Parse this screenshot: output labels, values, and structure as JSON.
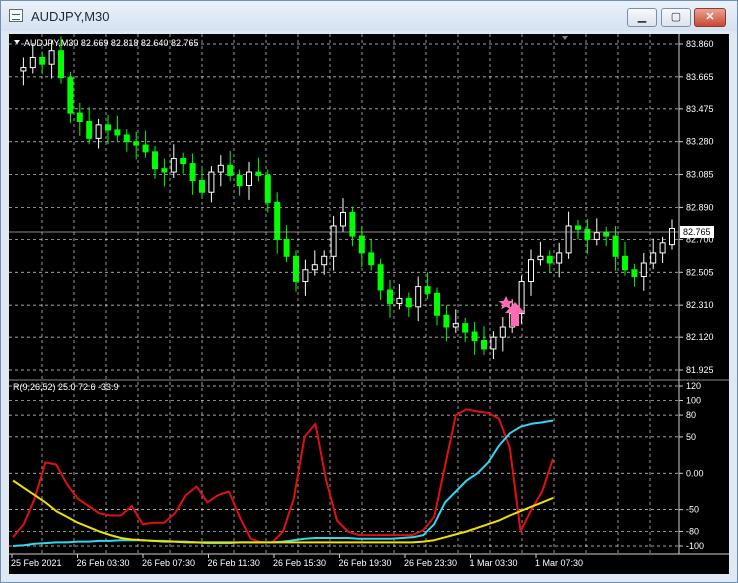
{
  "window": {
    "title": "AUDJPY,M30",
    "buttons": {
      "minimize": "▁",
      "maximize": "▢",
      "close": "✕"
    }
  },
  "chart": {
    "header": "AUDJPY,M30  82.669 82.818 82.640 82.765",
    "current_price_label": "82.765",
    "indicator_label": "R(9,26,52) 25.0 72.6 -33.9",
    "price_ticks": [
      "83.860",
      "83.665",
      "83.475",
      "83.280",
      "83.085",
      "82.890",
      "82.700",
      "82.505",
      "82.310",
      "82.120",
      "81.925"
    ],
    "indicator_ticks": [
      "120",
      "100",
      "80",
      "50",
      "0.00",
      "-50",
      "-80",
      "-100"
    ],
    "time_ticks": [
      "25 Feb 2021",
      "26 Feb 03:30",
      "26 Feb 07:30",
      "26 Feb 11:30",
      "26 Feb 15:30",
      "26 Feb 19:30",
      "26 Feb 23:30",
      "1 Mar 03:30",
      "1 Mar 07:30"
    ],
    "colors": {
      "background": "#000000",
      "bull": "#ffffff",
      "bear": "#00ff00",
      "grid": "#ffffff",
      "red": "#e01010",
      "cyan": "#30d8f0",
      "yellow": "#f0e000",
      "arrow": "#ff6ab4"
    },
    "marker_icon": "star-and-up-arrow"
  },
  "chart_data": [
    {
      "type": "candlestick",
      "title": "AUDJPY,M30",
      "x": [
        "25 Feb 2021",
        "26 Feb 03:30",
        "26 Feb 07:30",
        "26 Feb 11:30",
        "26 Feb 15:30",
        "26 Feb 19:30",
        "26 Feb 23:30",
        "1 Mar 03:30",
        "1 Mar 07:30"
      ],
      "ylim": [
        81.925,
        83.86
      ],
      "current_price": 82.765,
      "last_bar": {
        "open": 82.669,
        "high": 82.818,
        "low": 82.64,
        "close": 82.765
      },
      "close_path": [
        83.7,
        83.72,
        83.78,
        83.74,
        83.82,
        83.66,
        83.45,
        83.4,
        83.3,
        83.38,
        83.35,
        83.32,
        83.28,
        83.26,
        83.22,
        83.12,
        83.1,
        83.18,
        83.15,
        83.05,
        82.98,
        83.1,
        83.14,
        83.08,
        83.02,
        83.1,
        83.08,
        82.92,
        82.7,
        82.6,
        82.45,
        82.52,
        82.55,
        82.6,
        82.78,
        82.86,
        82.72,
        82.62,
        82.55,
        82.4,
        82.32,
        82.35,
        82.3,
        82.42,
        82.38,
        82.25,
        82.18,
        82.2,
        82.15,
        82.1,
        82.05,
        82.12,
        82.18,
        82.26,
        82.45,
        82.58,
        82.6,
        82.56,
        82.62,
        82.78,
        82.76,
        82.7,
        82.74,
        82.72,
        82.6,
        82.52,
        82.48,
        82.56,
        82.62,
        82.68,
        82.765
      ],
      "grid": true
    },
    {
      "type": "line",
      "ylim": [
        -100,
        120
      ],
      "series": [
        {
          "name": "",
          "color": "red",
          "values": [
            -88,
            -70,
            -35,
            15,
            12,
            -15,
            -35,
            -45,
            -55,
            -58,
            -58,
            -45,
            -70,
            -68,
            -68,
            -55,
            -30,
            -18,
            -40,
            -30,
            -25,
            -60,
            -90,
            -95,
            -95,
            -80,
            -35,
            50,
            68,
            -10,
            -65,
            -80,
            -85,
            -85,
            -85,
            -85,
            -85,
            -85,
            -78,
            -60,
            10,
            80,
            88,
            85,
            83,
            75,
            35,
            -80,
            -50,
            -25,
            20
          ]
        },
        {
          "name": "",
          "color": "cyan",
          "values": [
            -100,
            -99,
            -97,
            -96,
            -95,
            -95,
            -94,
            -94,
            -93,
            -93,
            -92,
            -92,
            -92,
            -93,
            -93,
            -94,
            -94,
            -95,
            -96,
            -96,
            -96,
            -95,
            -95,
            -95,
            -95,
            -94,
            -92,
            -90,
            -89,
            -89,
            -89,
            -89,
            -90,
            -90,
            -90,
            -90,
            -89,
            -88,
            -85,
            -70,
            -40,
            -25,
            -10,
            0,
            15,
            38,
            55,
            64,
            68,
            70,
            72.6
          ]
        },
        {
          "name": "",
          "color": "yellow",
          "values": [
            -10,
            -20,
            -30,
            -40,
            -52,
            -60,
            -68,
            -74,
            -80,
            -85,
            -89,
            -91,
            -92,
            -93,
            -94,
            -94,
            -95,
            -95,
            -95,
            -95,
            -95,
            -95,
            -95,
            -95,
            -95,
            -95,
            -95,
            -95,
            -95,
            -95,
            -95,
            -95,
            -95,
            -95,
            -95,
            -95,
            -95,
            -95,
            -94,
            -92,
            -88,
            -84,
            -80,
            -75,
            -70,
            -65,
            -58,
            -52,
            -46,
            -40,
            -33.9
          ]
        }
      ],
      "grid": true
    }
  ]
}
